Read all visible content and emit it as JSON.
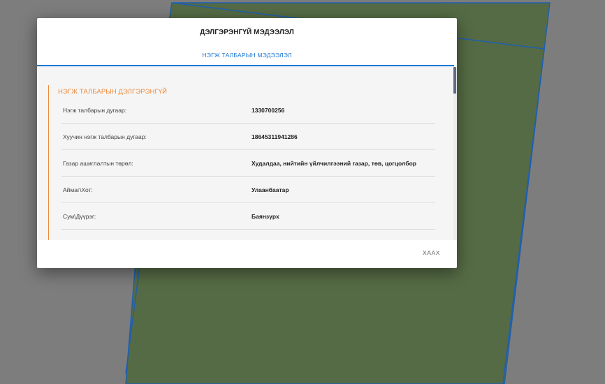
{
  "dialog": {
    "title": "ДЭЛГЭРЭНГҮЙ МЭДЭЭЛЭЛ",
    "tab_label": "НЭГЖ ТАЛБАРЫН МЭДЭЭЛЭЛ",
    "section_title": "НЭГЖ ТАЛБАРЫН ДЭЛГЭРЭНГҮЙ",
    "rows": [
      {
        "label": "Нэгж талбарын дугаар:",
        "value": "1330700256"
      },
      {
        "label": "Хуучин нэгж талбарын дугаар:",
        "value": "18645311941286"
      },
      {
        "label": "Газар ашиглалтын төрөл:",
        "value": "Худалдаа, нийтийн үйлчилгээний газар, төв, цогцолбор"
      },
      {
        "label": "Аймаг\\Хот:",
        "value": "Улаанбаатар"
      },
      {
        "label": "Сум\\Дүүрэг:",
        "value": "Баянзүрх"
      }
    ],
    "close_label": "ХААХ"
  },
  "colors": {
    "accent": "#1976d2",
    "section_accent": "#ef8a3a",
    "parcel_fill": "#556b45",
    "parcel_border": "#1f5fb0"
  }
}
